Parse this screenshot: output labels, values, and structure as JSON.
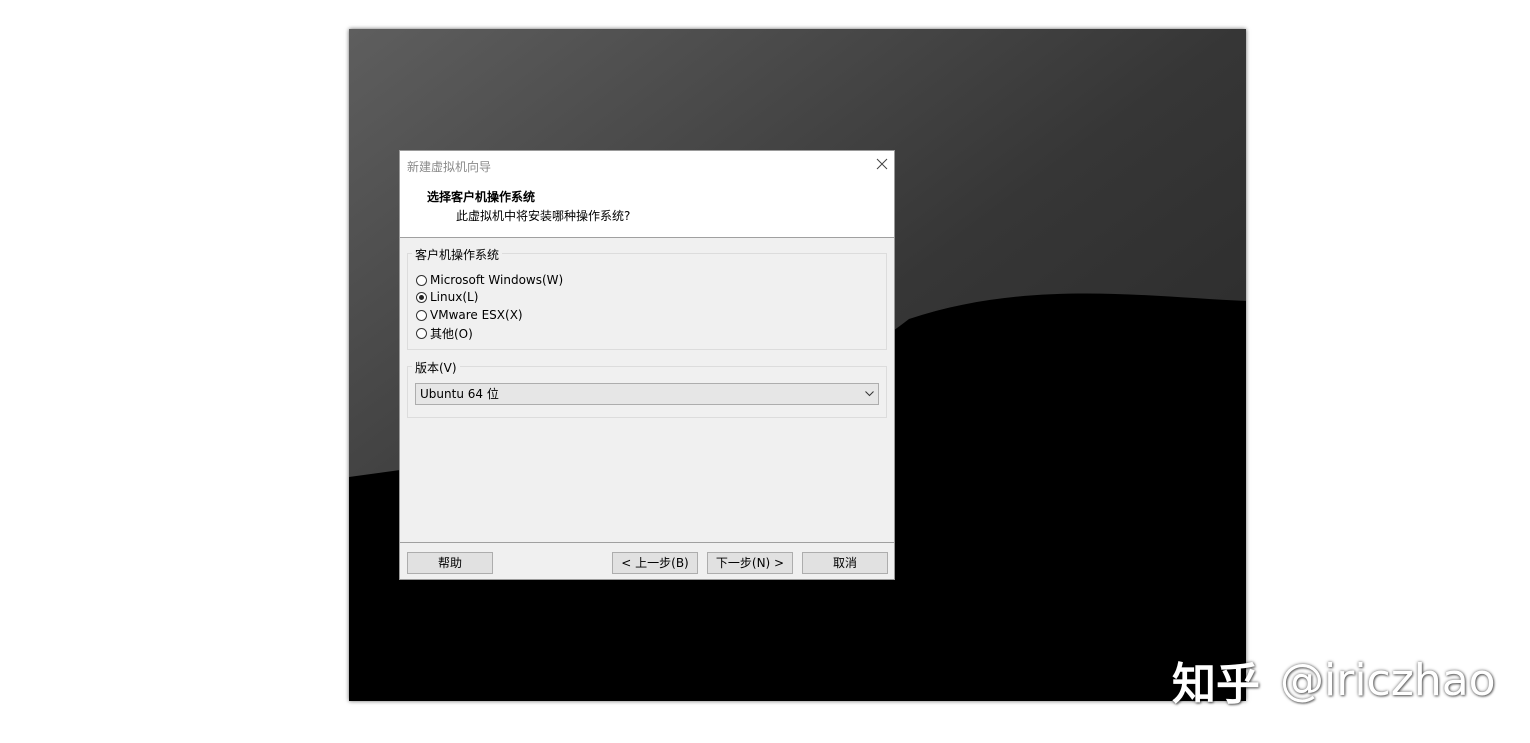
{
  "window": {
    "title": "新建虚拟机向导"
  },
  "header": {
    "title": "选择客户机操作系统",
    "subtitle": "此虚拟机中将安装哪种操作系统?"
  },
  "guest_os_group": {
    "label": "客户机操作系统",
    "options": [
      {
        "label": "Microsoft Windows(W)",
        "checked": false
      },
      {
        "label": "Linux(L)",
        "checked": true
      },
      {
        "label": "VMware ESX(X)",
        "checked": false
      },
      {
        "label": "其他(O)",
        "checked": false
      }
    ]
  },
  "version_group": {
    "label": "版本(V)",
    "selected": "Ubuntu 64 位"
  },
  "buttons": {
    "help": "帮助",
    "back": "< 上一步(B)",
    "next": "下一步(N) >",
    "cancel": "取消"
  },
  "watermark": {
    "brand": "知乎",
    "handle": "@iriczhao"
  },
  "icons": {
    "close": "close-icon",
    "dropdown": "chevron-down-icon"
  },
  "colors": {
    "dialog_bg": "#f0f0f0",
    "header_bg": "#ffffff",
    "button_bg": "#e1e1e1"
  }
}
